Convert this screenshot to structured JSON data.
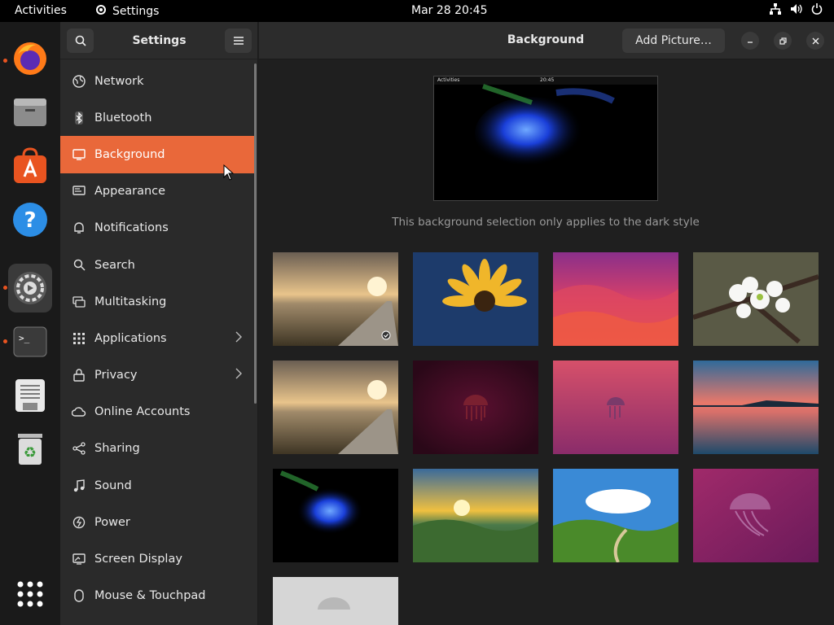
{
  "topbar": {
    "activities": "Activities",
    "app_name": "Settings",
    "clock": "Mar 28  20:45"
  },
  "dock": {
    "items": [
      {
        "icon": "firefox-icon",
        "running": true
      },
      {
        "icon": "files-icon",
        "running": false
      },
      {
        "icon": "app-center-icon",
        "running": false
      },
      {
        "icon": "help-icon",
        "running": false
      },
      {
        "icon": "settings-icon",
        "running": true,
        "active": true
      },
      {
        "icon": "terminal-icon",
        "running": true
      },
      {
        "icon": "text-editor-icon",
        "running": false
      },
      {
        "icon": "trash-icon",
        "running": false
      }
    ],
    "show_apps_icon": "grid-icon"
  },
  "sidebar": {
    "title": "Settings",
    "items": [
      {
        "label": "Network",
        "icon": "globe-icon"
      },
      {
        "label": "Bluetooth",
        "icon": "bluetooth-icon"
      },
      {
        "label": "Background",
        "icon": "display-icon",
        "selected": true
      },
      {
        "label": "Appearance",
        "icon": "appearance-icon"
      },
      {
        "label": "Notifications",
        "icon": "bell-icon"
      },
      {
        "label": "Search",
        "icon": "search-icon"
      },
      {
        "label": "Multitasking",
        "icon": "multitasking-icon"
      },
      {
        "label": "Applications",
        "icon": "apps-grid-icon",
        "chevron": true
      },
      {
        "label": "Privacy",
        "icon": "lock-icon",
        "chevron": true
      },
      {
        "label": "Online Accounts",
        "icon": "cloud-icon"
      },
      {
        "label": "Sharing",
        "icon": "share-icon"
      },
      {
        "label": "Sound",
        "icon": "music-icon"
      },
      {
        "label": "Power",
        "icon": "power-icon"
      },
      {
        "label": "Screen Display",
        "icon": "monitor-icon"
      },
      {
        "label": "Mouse & Touchpad",
        "icon": "mouse-icon"
      }
    ]
  },
  "main": {
    "title": "Background",
    "add_button": "Add Picture…",
    "preview": {
      "activities": "Activities",
      "clock": "20:45"
    },
    "note": "This background selection only applies to the dark style"
  },
  "wallpapers": [
    {
      "name": "boardwalk-sunset",
      "selected": true
    },
    {
      "name": "yellow-flower"
    },
    {
      "name": "orange-waves"
    },
    {
      "name": "cherry-blossoms"
    },
    {
      "name": "boardwalk-sunset-2"
    },
    {
      "name": "dark-jellyfish"
    },
    {
      "name": "pink-jellyfish"
    },
    {
      "name": "lake-sunset"
    },
    {
      "name": "blue-jellyfish"
    },
    {
      "name": "valley-sunrise"
    },
    {
      "name": "green-hills"
    },
    {
      "name": "purple-jellyfish"
    },
    {
      "name": "grey-jellyfish"
    }
  ]
}
